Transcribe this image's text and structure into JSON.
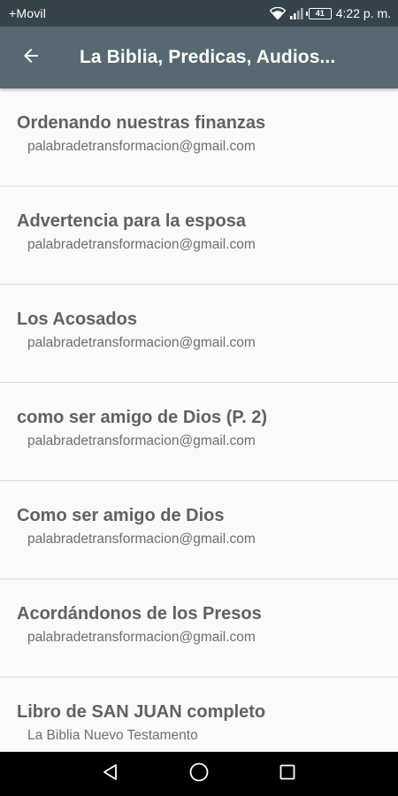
{
  "status_bar": {
    "carrier": "+Movil",
    "battery": "41",
    "time": "4:22 p. m.",
    "icons": [
      "wifi-icon",
      "signal-icon",
      "battery-icon"
    ]
  },
  "app_bar": {
    "title": "La Biblia, Predicas, Audios...",
    "back_icon": "arrow-back-icon"
  },
  "items": [
    {
      "title": "Ordenando nuestras finanzas",
      "subtitle": "palabradetransformacion@gmail.com"
    },
    {
      "title": "Advertencia para la esposa",
      "subtitle": "palabradetransformacion@gmail.com"
    },
    {
      "title": "Los Acosados",
      "subtitle": "palabradetransformacion@gmail.com"
    },
    {
      "title": "como ser amigo de Dios (P. 2)",
      "subtitle": "palabradetransformacion@gmail.com"
    },
    {
      "title": "Como ser amigo de Dios",
      "subtitle": "palabradetransformacion@gmail.com"
    },
    {
      "title": "Acordándonos de los Presos",
      "subtitle": "palabradetransformacion@gmail.com"
    },
    {
      "title": "Libro de SAN JUAN completo",
      "subtitle": "La Biblia Nuevo Testamento"
    }
  ],
  "nav_bar": {
    "icons": [
      "back-triangle-icon",
      "home-circle-icon",
      "recents-square-icon"
    ]
  },
  "colors": {
    "status_bar": "#35434a",
    "app_bar": "#566870",
    "list_background": "#fafafa",
    "divider": "#dcdcdc",
    "title_text": "#616161",
    "subtitle_text": "#6e6e6e",
    "nav_bar": "#000000"
  }
}
